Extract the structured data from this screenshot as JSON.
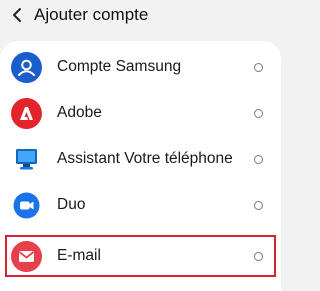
{
  "header": {
    "title": "Ajouter compte",
    "back_icon": "chevron-left-icon"
  },
  "accounts": [
    {
      "label": "Compte Samsung",
      "icon": "samsung-account-icon",
      "color": "#1a5ecb",
      "selected": false
    },
    {
      "label": "Adobe",
      "icon": "adobe-icon",
      "color": "#e3242b",
      "selected": false
    },
    {
      "label": "Assistant Votre téléphone",
      "icon": "your-phone-icon",
      "color": "#1e88e5",
      "selected": false
    },
    {
      "label": "Duo",
      "icon": "duo-icon",
      "color": "#1a73e8",
      "selected": false
    },
    {
      "label": "E-mail",
      "icon": "email-icon",
      "color": "#e8404a",
      "selected": false
    }
  ],
  "highlight_color": "#d32433"
}
